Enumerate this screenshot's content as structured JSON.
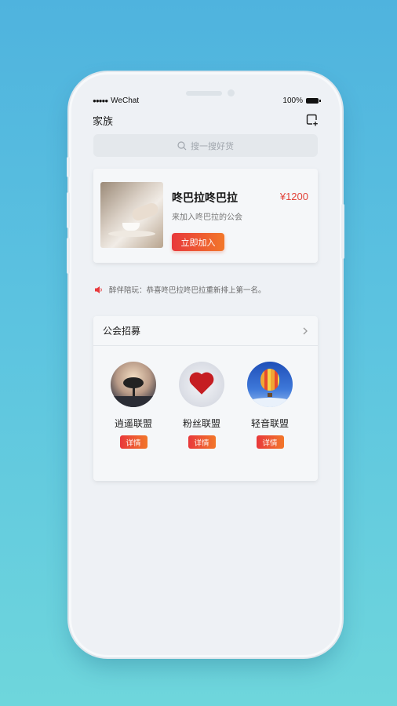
{
  "status_bar": {
    "carrier": "WeChat",
    "signal": "●●●●●",
    "battery": "100%"
  },
  "header": {
    "title": "家族"
  },
  "search": {
    "placeholder": "搜一搜好货"
  },
  "featured_guild": {
    "name": "咚巴拉咚巴拉",
    "price": "¥1200",
    "description": "来加入咚巴拉的公会",
    "join_label": "立即加入"
  },
  "notice": {
    "text": "醉伴陪玩：恭喜咚巴拉咚巴拉重新排上第一名。"
  },
  "recruit": {
    "title": "公会招募",
    "guilds": [
      {
        "name": "逍遥联盟",
        "detail_label": "详情"
      },
      {
        "name": "粉丝联盟",
        "detail_label": "详情"
      },
      {
        "name": "轻音联盟",
        "detail_label": "详情"
      }
    ]
  },
  "colors": {
    "accent_start": "#e8383b",
    "accent_end": "#f2772a",
    "price": "#e2443a"
  }
}
